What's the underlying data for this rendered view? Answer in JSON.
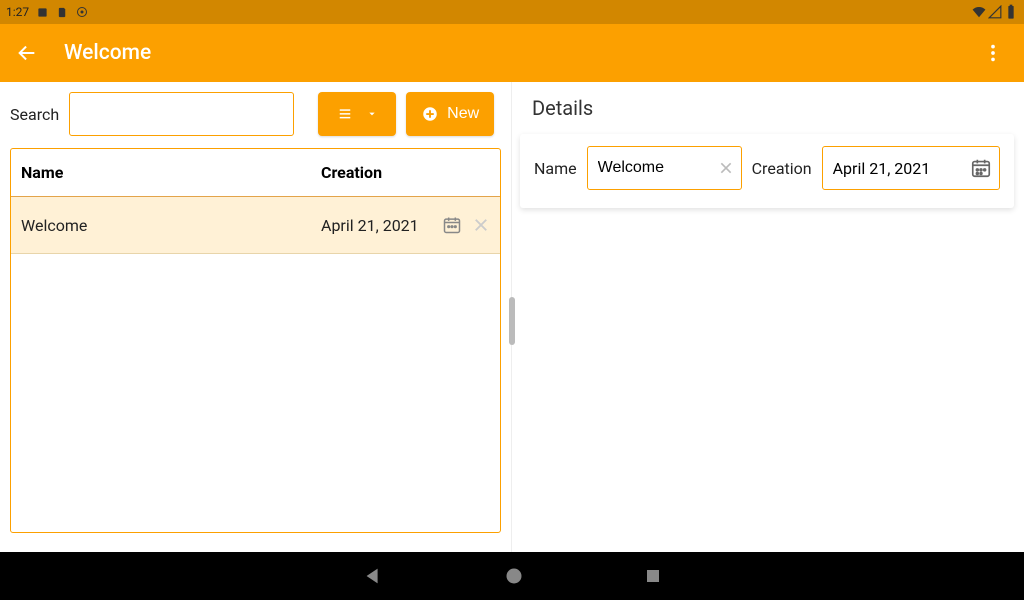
{
  "status": {
    "time": "1:27"
  },
  "appbar": {
    "title": "Welcome"
  },
  "left": {
    "search_label": "Search",
    "search_value": "",
    "new_label": "New",
    "columns": {
      "name": "Name",
      "creation": "Creation"
    },
    "rows": [
      {
        "name": "Welcome",
        "creation": "April 21, 2021"
      }
    ]
  },
  "details": {
    "title": "Details",
    "name_label": "Name",
    "name_value": "Welcome",
    "creation_label": "Creation",
    "creation_value": "April 21, 2021"
  }
}
